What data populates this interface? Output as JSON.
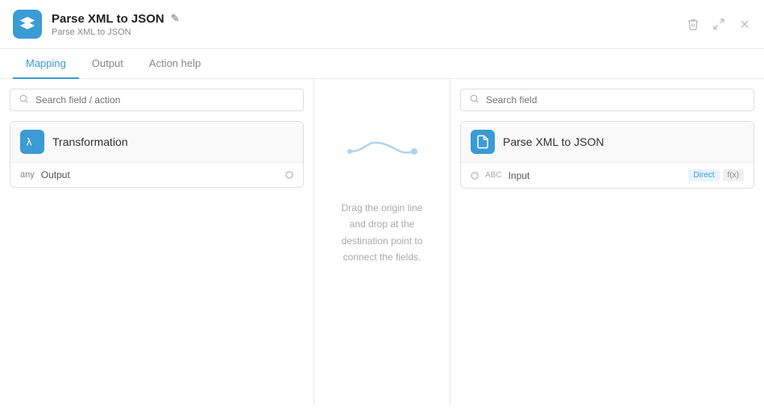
{
  "window": {
    "title": "Parse XML to JSON",
    "subtitle": "Parse XML to JSON",
    "edit_icon": "✎"
  },
  "toolbar": {
    "delete_label": "🗑",
    "expand_label": "⤢",
    "close_label": "✕"
  },
  "tabs": [
    {
      "id": "mapping",
      "label": "Mapping",
      "active": true
    },
    {
      "id": "output",
      "label": "Output",
      "active": false
    },
    {
      "id": "action-help",
      "label": "Action help",
      "active": false
    }
  ],
  "left_panel": {
    "search_placeholder": "Search field / action",
    "field_group": {
      "icon": "lambda",
      "name": "Transformation",
      "fields": [
        {
          "type": "any",
          "name": "Output"
        }
      ]
    }
  },
  "right_panel": {
    "search_placeholder": "Search field",
    "field_group": {
      "icon": "parse",
      "name": "Parse XML to JSON",
      "fields": [
        {
          "type": "ABC",
          "name": "Input",
          "badge_direct": "Direct",
          "badge_fn": "f(x)"
        }
      ]
    }
  },
  "middle": {
    "drag_hint": "Drag the origin line and drop at the destination point to connect the fields."
  },
  "colors": {
    "accent": "#3a9bd5",
    "border": "#e0e0e0",
    "text_muted": "#aaaaaa"
  }
}
